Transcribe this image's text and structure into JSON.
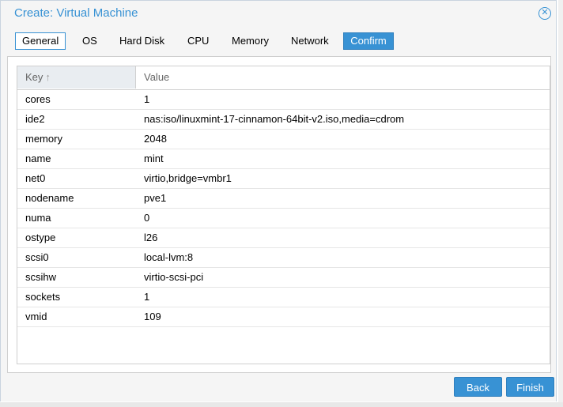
{
  "window": {
    "title": "Create: Virtual Machine",
    "close_icon": "✕"
  },
  "tabs": [
    {
      "label": "General"
    },
    {
      "label": "OS"
    },
    {
      "label": "Hard Disk"
    },
    {
      "label": "CPU"
    },
    {
      "label": "Memory"
    },
    {
      "label": "Network"
    },
    {
      "label": "Confirm"
    }
  ],
  "active_tab": "Confirm",
  "grid": {
    "headers": {
      "key": "Key",
      "value": "Value",
      "sort_icon": "↑"
    },
    "rows": [
      {
        "key": "cores",
        "value": "1"
      },
      {
        "key": "ide2",
        "value": "nas:iso/linuxmint-17-cinnamon-64bit-v2.iso,media=cdrom"
      },
      {
        "key": "memory",
        "value": "2048"
      },
      {
        "key": "name",
        "value": "mint"
      },
      {
        "key": "net0",
        "value": "virtio,bridge=vmbr1"
      },
      {
        "key": "nodename",
        "value": "pve1"
      },
      {
        "key": "numa",
        "value": "0"
      },
      {
        "key": "ostype",
        "value": "l26"
      },
      {
        "key": "scsi0",
        "value": "local-lvm:8"
      },
      {
        "key": "scsihw",
        "value": "virtio-scsi-pci"
      },
      {
        "key": "sockets",
        "value": "1"
      },
      {
        "key": "vmid",
        "value": "109"
      }
    ]
  },
  "footer": {
    "back_label": "Back",
    "finish_label": "Finish"
  },
  "colors": {
    "accent": "#3892d4",
    "header_key_bg": "#e9edf1"
  }
}
